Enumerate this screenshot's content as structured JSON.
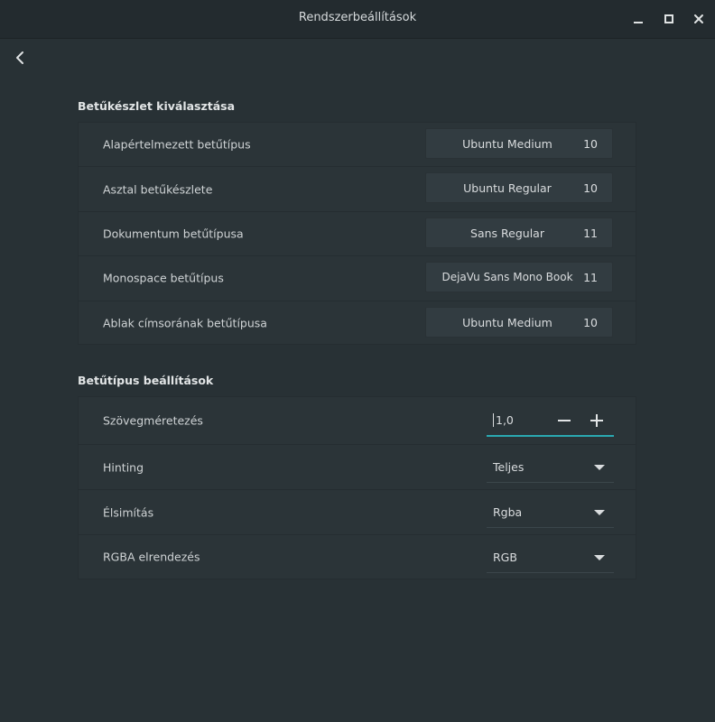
{
  "window": {
    "title": "Rendszerbeállítások"
  },
  "icons": {
    "back": "chevron-left-icon",
    "minimize": "minimize-icon",
    "maximize": "maximize-icon",
    "close": "close-icon"
  },
  "font_selection": {
    "title": "Betűkészlet kiválasztása",
    "rows": [
      {
        "label": "Alapértelmezett betűtípus",
        "font": "Ubuntu Medium",
        "size": "10"
      },
      {
        "label": "Asztal betűkészlete",
        "font": "Ubuntu Regular",
        "size": "10"
      },
      {
        "label": "Dokumentum betűtípusa",
        "font": "Sans Regular",
        "size": "11"
      },
      {
        "label": "Monospace betűtípus",
        "font": "DejaVu Sans Mono Book",
        "size": "11"
      },
      {
        "label": "Ablak címsorának betűtípusa",
        "font": "Ubuntu Medium",
        "size": "10"
      }
    ]
  },
  "font_settings": {
    "title": "Betűtípus beállítások",
    "scaling": {
      "label": "Szövegméretezés",
      "value": "1,0"
    },
    "hinting": {
      "label": "Hinting",
      "value": "Teljes"
    },
    "antialiasing": {
      "label": "Élsimítás",
      "value": "Rgba"
    },
    "rgba_order": {
      "label": "RGBA elrendezés",
      "value": "RGB"
    }
  },
  "colors": {
    "background": "#283135",
    "panel": "#2b3438",
    "accent": "#2aa8b1"
  }
}
